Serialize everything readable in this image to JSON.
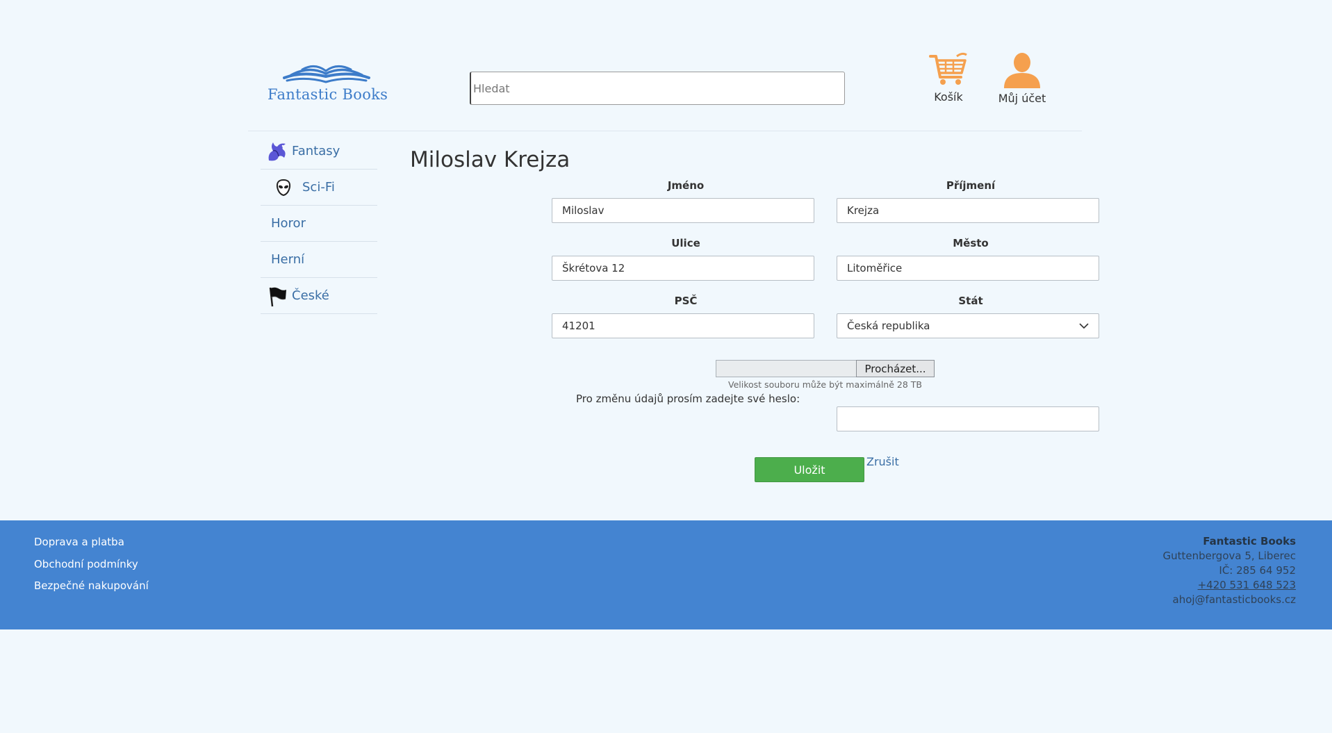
{
  "header": {
    "logo_text": "Fantastic Books",
    "search_placeholder": "Hledat",
    "cart_label": "Košík",
    "account_label": "Můj účet",
    "accent_color": "#f5a04e"
  },
  "sidebar": {
    "items": [
      {
        "label": "Fantasy",
        "icon": "dragon-icon"
      },
      {
        "label": "Sci-Fi",
        "icon": "alien-icon"
      },
      {
        "label": "Horor"
      },
      {
        "label": "Herní"
      },
      {
        "label": "České",
        "icon": "flag-icon"
      }
    ]
  },
  "profile": {
    "title": "Miloslav Krejza",
    "first_name_label": "Jméno",
    "first_name_value": "Miloslav",
    "last_name_label": "Příjmení",
    "last_name_value": "Krejza",
    "street_label": "Ulice",
    "street_value": "Škrétova 12",
    "city_label": "Město",
    "city_value": "Litoměřice",
    "zip_label": "PSČ",
    "zip_value": "41201",
    "country_label": "Stát",
    "country_value": "Česká republika",
    "browse_label": "Procházet...",
    "file_note": "Velikost souboru může být maximálně 28 TB",
    "password_prompt": "Pro změnu údajů prosím zadejte své heslo:",
    "save_label": "Uložit",
    "cancel_label": "Zrušit",
    "save_color": "#4cae4c"
  },
  "footer": {
    "links": [
      "Doprava a platba",
      "Obchodní podmínky",
      "Bezpečné nakupování"
    ],
    "company_name": "Fantastic Books",
    "address": "Guttenbergova 5, Liberec",
    "ic": "IČ: 285 64 952",
    "phone": "+420 531 648 523",
    "email": "ahoj@fantasticbooks.cz",
    "background_color": "#4484d1"
  }
}
